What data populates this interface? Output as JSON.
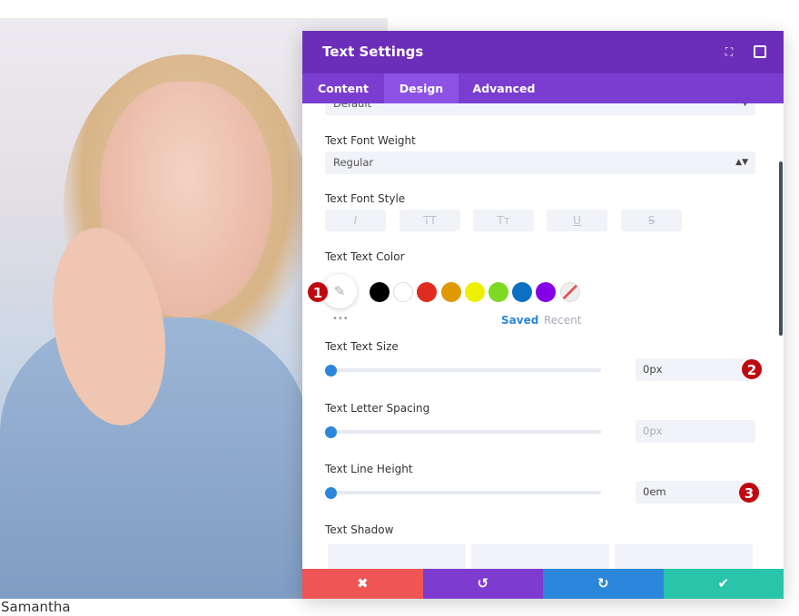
{
  "caption": "Samantha",
  "panel": {
    "title": "Text Settings",
    "header_icons": [
      "fullscreen-icon",
      "split-view-icon"
    ],
    "tabs": [
      {
        "label": "Content"
      },
      {
        "label": "Design",
        "active": true
      },
      {
        "label": "Advanced"
      }
    ],
    "font_select_value": "Default",
    "font_weight": {
      "label": "Text Font Weight",
      "value": "Regular"
    },
    "font_style": {
      "label": "Text Font Style",
      "buttons": [
        "I",
        "TT",
        "Tт",
        "U",
        "S"
      ]
    },
    "text_color": {
      "label": "Text Text Color",
      "swatches": [
        "#000000",
        "#ffffff",
        "#e02b20",
        "#e09900",
        "#edf000",
        "#7cda24",
        "#0c71c3",
        "#8300e9",
        "none"
      ],
      "saved": "Saved",
      "recent": "Recent",
      "more": "•••"
    },
    "text_size": {
      "label": "Text Text Size",
      "value": "0px",
      "slider": 0
    },
    "letter_spacing": {
      "label": "Text Letter Spacing",
      "placeholder": "0px",
      "slider": 0
    },
    "line_height": {
      "label": "Text Line Height",
      "value": "0em",
      "slider": 0
    },
    "text_shadow": {
      "label": "Text Shadow"
    },
    "badges": [
      "1",
      "2",
      "3"
    ],
    "footer": {
      "colors": [
        "#ef5555",
        "#7e3bd0",
        "#2b87da",
        "#29c4a9"
      ],
      "icons": [
        "close-icon",
        "undo-icon",
        "redo-icon",
        "check-icon"
      ],
      "glyphs": [
        "✖",
        "↺",
        "↻",
        "✔"
      ]
    }
  }
}
